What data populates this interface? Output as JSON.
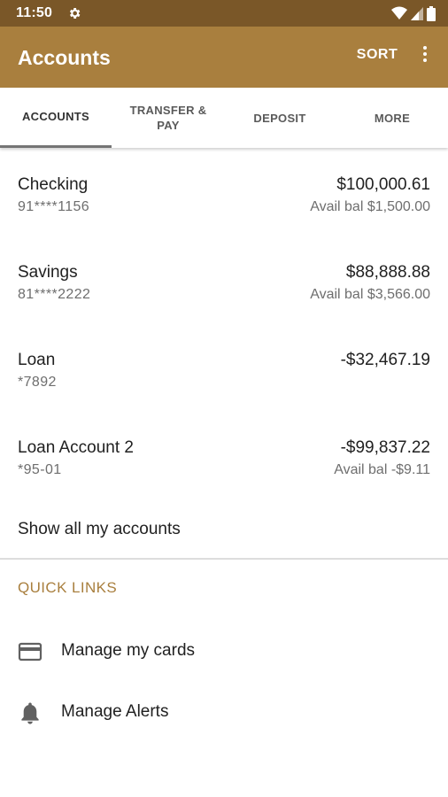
{
  "status_bar": {
    "time": "11:50"
  },
  "app_bar": {
    "title": "Accounts",
    "sort_label": "SORT"
  },
  "tabs": [
    {
      "label": "ACCOUNTS",
      "active": true
    },
    {
      "label": "TRANSFER & PAY",
      "active": false
    },
    {
      "label": "DEPOSIT",
      "active": false
    },
    {
      "label": "MORE",
      "active": false
    }
  ],
  "accounts": [
    {
      "name": "Checking",
      "number": "91****1156",
      "balance": "$100,000.61",
      "avail": "Avail bal $1,500.00"
    },
    {
      "name": "Savings",
      "number": "81****2222",
      "balance": "$88,888.88",
      "avail": "Avail bal $3,566.00"
    },
    {
      "name": "Loan",
      "number": "*7892",
      "balance": "-$32,467.19",
      "avail": ""
    },
    {
      "name": "Loan Account 2",
      "number": "*95-01",
      "balance": "-$99,837.22",
      "avail": "Avail bal -$9.11"
    }
  ],
  "show_all_label": "Show all my accounts",
  "quick_links": {
    "header": "QUICK LINKS",
    "items": [
      {
        "label": "Manage my cards",
        "icon": "credit-card-icon"
      },
      {
        "label": "Manage Alerts",
        "icon": "bell-icon"
      }
    ]
  },
  "colors": {
    "status_bar": "#7a5728",
    "app_bar": "#a97f3e",
    "accent": "#a97f3e"
  }
}
